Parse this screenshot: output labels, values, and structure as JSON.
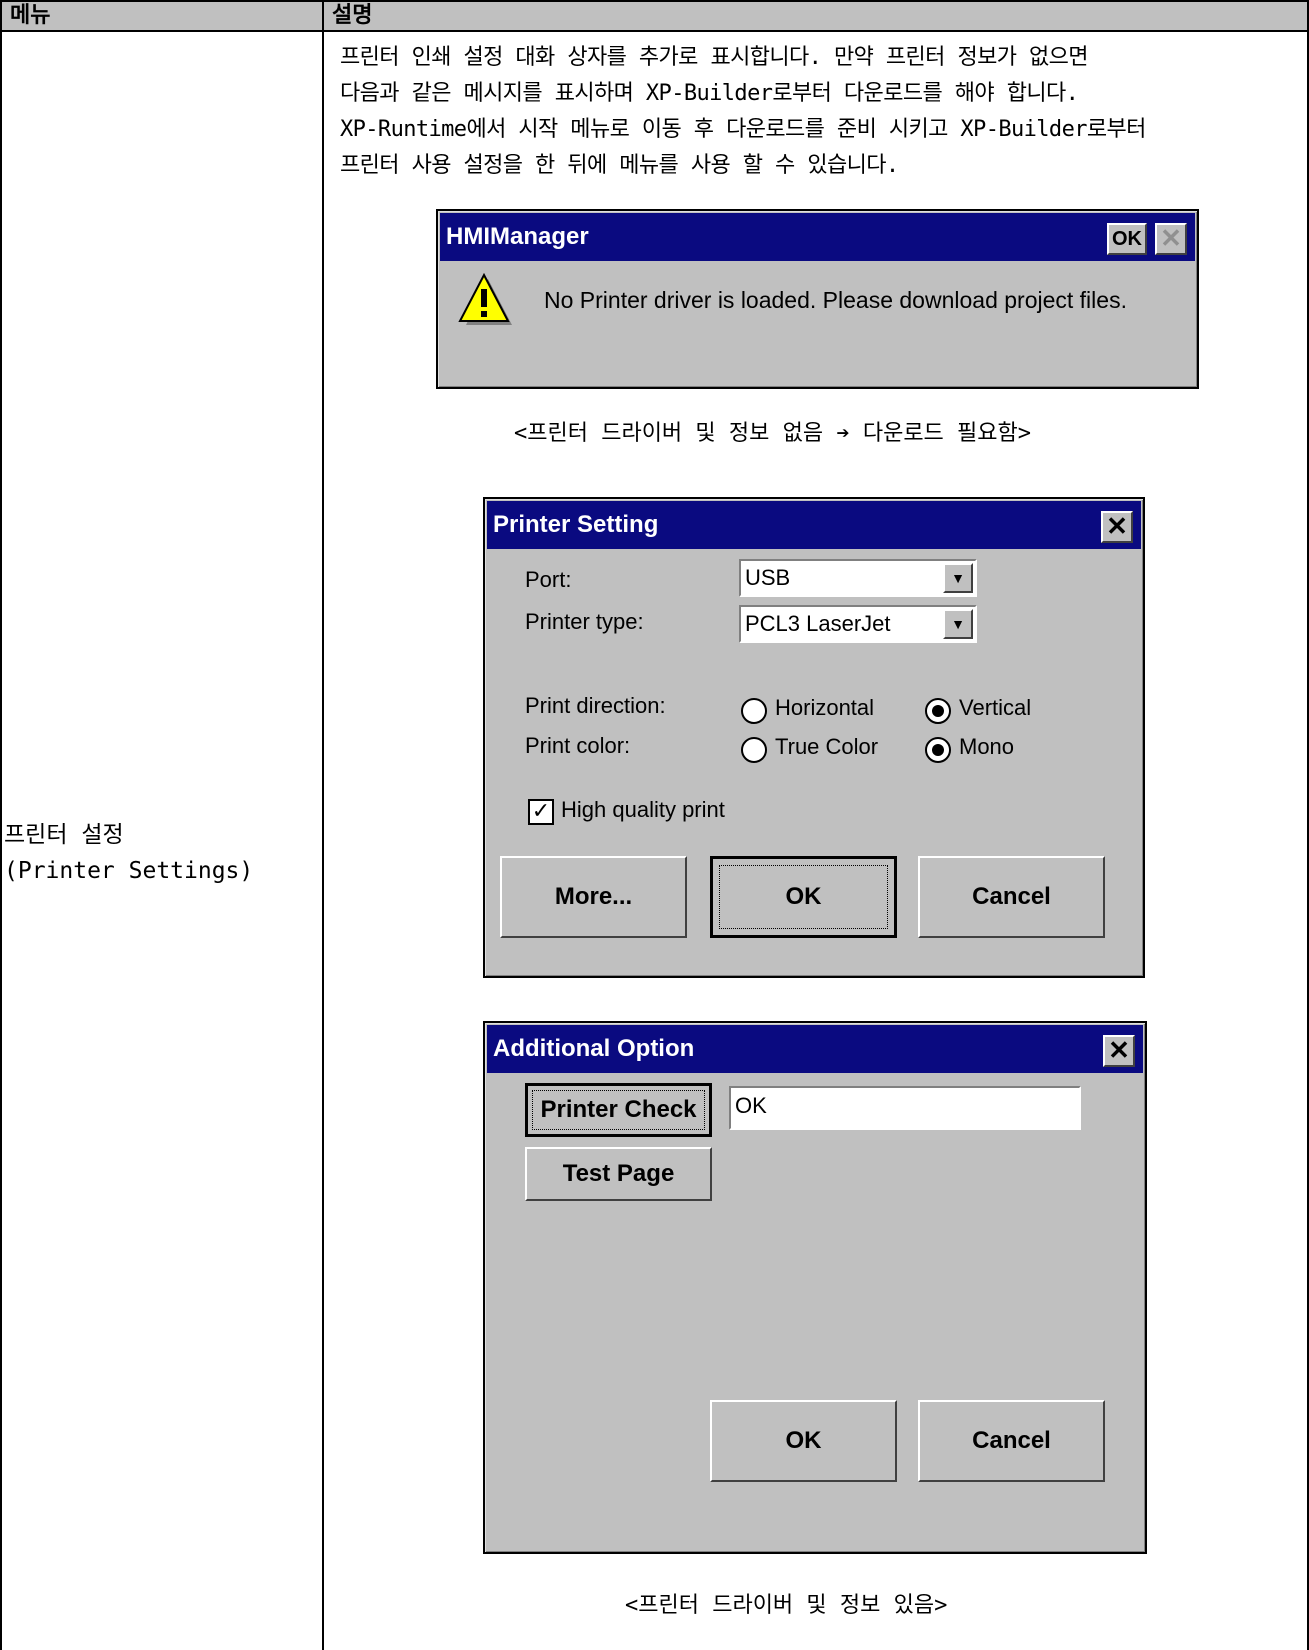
{
  "table": {
    "header_menu": "메뉴",
    "header_description": "설명",
    "menu_label_line1": "프린터 설정",
    "menu_label_line2": "(Printer Settings)"
  },
  "description": {
    "line1": "프린터 인쇄 설정 대화 상자를 추가로 표시합니다. 만약 프린터 정보가 없으면",
    "line2": "다음과 같은 메시지를 표시하며 XP-Builder로부터 다운로드를 해야 합니다.",
    "line3": "XP-Runtime에서 시작 메뉴로 이동 후 다운로드를 준비 시키고 XP-Builder로부터",
    "line4": "프린터 사용 설정을 한 뒤에 메뉴를 사용 할 수 있습니다."
  },
  "hmi_dialog": {
    "title": "HMIManager",
    "ok_label": "OK",
    "close_glyph": "✕",
    "message": "No Printer driver is loaded. Please download project files.",
    "icon": "warning-icon"
  },
  "caption_no_driver": "<프린터 드라이버 및 정보 없음 ➔ 다운로드 필요함>",
  "printer_setting": {
    "title": "Printer Setting",
    "close_glyph": "✕",
    "port_label": "Port:",
    "port_value": "USB",
    "printer_type_label": "Printer type:",
    "printer_type_value": "PCL3 LaserJet",
    "dropdown_glyph": "▼",
    "direction_label": "Print direction:",
    "direction_options": [
      "Horizontal",
      "Vertical"
    ],
    "direction_selected": "Vertical",
    "color_label": "Print color:",
    "color_options": [
      "True Color",
      "Mono"
    ],
    "color_selected": "Mono",
    "high_quality_label": "High quality print",
    "high_quality_checked": true,
    "check_glyph": "✓",
    "more_button": "More...",
    "ok_button": "OK",
    "cancel_button": "Cancel"
  },
  "additional_option": {
    "title": "Additional Option",
    "close_glyph": "✕",
    "printer_check_button": "Printer Check",
    "status_value": "OK",
    "test_page_button": "Test Page",
    "ok_button": "OK",
    "cancel_button": "Cancel"
  },
  "caption_with_driver": "<프린터 드라이버 및 정보 있음>"
}
